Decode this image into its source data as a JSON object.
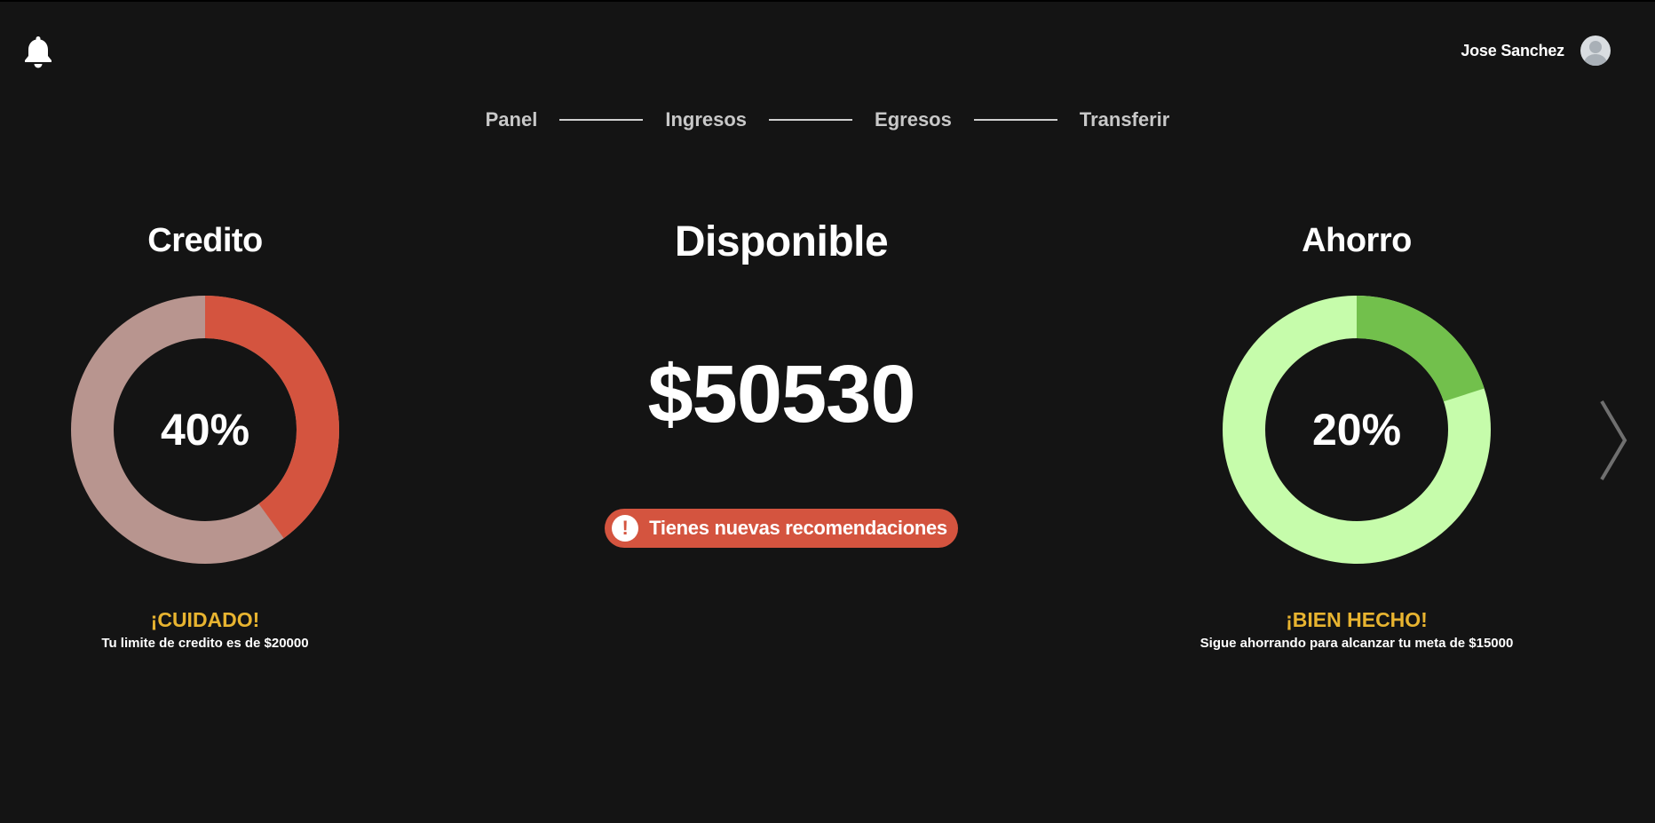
{
  "header": {
    "user_name": "Jose Sanchez",
    "icons": {
      "notifications": "bell-icon",
      "avatar": "user-avatar-icon"
    }
  },
  "nav": {
    "items": [
      "Panel",
      "Ingresos",
      "Egresos",
      "Transferir"
    ]
  },
  "credito": {
    "title": "Credito",
    "percent_label": "40%",
    "fraction": 0.4,
    "alert_title": "¡CUIDADO!",
    "alert_text": "Tu limite de credito es de $20000",
    "colors": {
      "filled": "#d4543f",
      "rest": "#b8958f"
    }
  },
  "disponible": {
    "title": "Disponible",
    "amount": "$50530",
    "recommendation": "Tienes nuevas recomendaciones",
    "recommendation_icon": "!"
  },
  "ahorro": {
    "title": "Ahorro",
    "percent_label": "20%",
    "fraction": 0.2,
    "alert_title": "¡BIEN HECHO!",
    "alert_text": "Sigue ahorrando para alcanzar tu meta de $15000",
    "colors": {
      "filled": "#72c04c",
      "rest": "#c6fcab"
    }
  },
  "colors": {
    "background": "#141414",
    "alert_yellow": "#e8b430",
    "accent_red": "#d4543f"
  },
  "next_icon": "chevron-right-icon"
}
